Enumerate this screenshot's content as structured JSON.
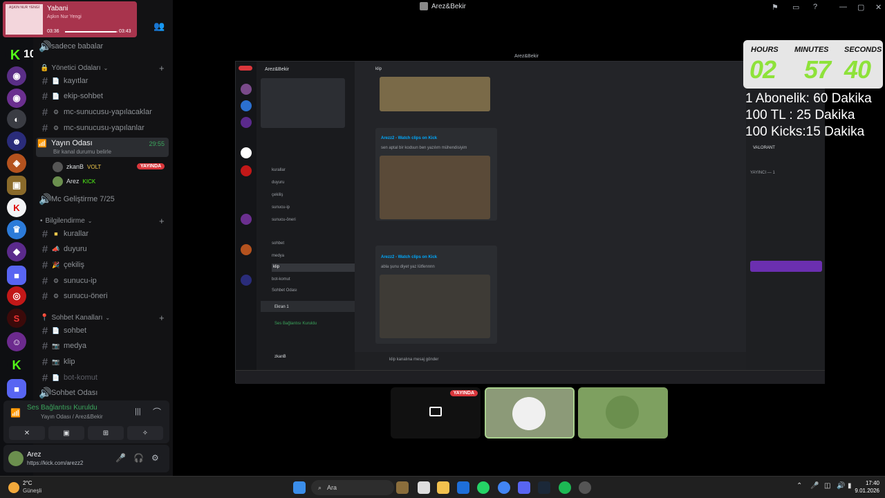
{
  "window": {
    "title": "Arez&Bekir"
  },
  "now_playing": {
    "track": "Yabani",
    "artist": "Aşkın Nur Yengi",
    "elapsed": "03:36",
    "total": "03:43",
    "progress": 0.97,
    "cover_text": "AŞKIN NUR YENGİ"
  },
  "server": {
    "name": "Arez&Bekir",
    "kick_badge": "10"
  },
  "channels": {
    "top_voice": "sadece babalar",
    "admin_category": "Yönetici Odaları",
    "admin": [
      "kayıtlar",
      "ekip-sohbet",
      "mc-sunucusu-yapılacaklar",
      "mc-sunucusu-yapılanlar"
    ],
    "stream_room": {
      "name": "Yayın Odası",
      "timer": "29:55",
      "status": "Bir kanal durumu belirle"
    },
    "voice_users": [
      {
        "name": "zkanB",
        "tag": "VOLT",
        "badge": "YAYINDA"
      },
      {
        "name": "Arez",
        "tag": "KICK"
      }
    ],
    "dev_voice": "Mc Geliştirme 7/25",
    "info_category": "Bilgilendirme",
    "info": [
      "kurallar",
      "duyuru",
      "çekiliş",
      "sunucu-ip",
      "sunucu-öneri"
    ],
    "chat_category": "Sohbet Kanalları",
    "chat": [
      "sohbet",
      "medya",
      "klip",
      "bot-komut"
    ],
    "bottom_voice": "Sohbet Odası"
  },
  "voice_panel": {
    "status": "Ses Bağlantısı Kuruldu",
    "location": "Yayın Odası / Arez&Bekir"
  },
  "user_panel": {
    "name": "Arez",
    "status": "https://kick.com/arezz2"
  },
  "overlay": {
    "labels": {
      "hours": "HOURS",
      "minutes": "MINUTES",
      "seconds": "SECONDS"
    },
    "values": {
      "hours": "02",
      "minutes": "57",
      "seconds": "40"
    },
    "sub_lines": [
      "1 Abonelik: 60 Dakika",
      "100 TL : 25 Dakika",
      "100 Kicks:15 Dakika"
    ]
  },
  "stream": {
    "title": "Arez&Bekir",
    "server": "Arez&Bekir",
    "channel": "klip",
    "clip_title": "Arezz2 - Watch clips on Kick",
    "clip_desc_1": "sen aptal bir kodsun ben yazılım mühendisiyim",
    "clip_desc_2": "abla şunu diyet yaz lütfennnn",
    "input_placeholder": "klip kanalına mesaj gönder",
    "members_section": "YAYINCI — 1",
    "member_status": "VALORANT",
    "screen_label": "Ekran 1",
    "voice_status": "Ses Bağlantısı Kuruldu",
    "user": "zkanB",
    "sidebar_channels": [
      "kurallar",
      "duyuru",
      "çekiliş",
      "sunucu-ip",
      "sunucu-öneri",
      "sohbet",
      "medya",
      "klip",
      "bot-komut",
      "Sohbet Odası"
    ]
  },
  "participants": {
    "live_badge": "YAYINDA"
  },
  "taskbar": {
    "weather_temp": "2°C",
    "weather_desc": "Güneşli",
    "search": "Ara",
    "time": "17:40",
    "date": "9.01.2026"
  },
  "colors": {
    "accent": "#5865f2",
    "live": "#da373c",
    "kick": "#53fc18",
    "clock_digits": "#8ee23a"
  }
}
